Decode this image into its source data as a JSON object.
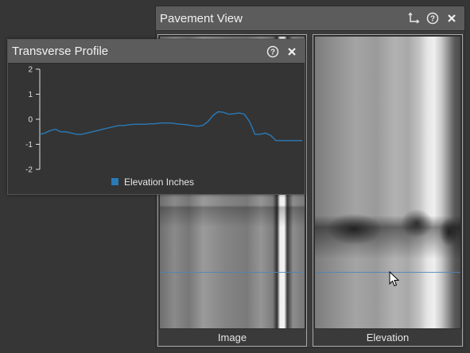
{
  "pavement_view": {
    "title": "Pavement View",
    "panes": [
      {
        "label": "Image"
      },
      {
        "label": "Elevation"
      }
    ]
  },
  "transverse_profile": {
    "title": "Transverse Profile"
  },
  "icons": {
    "move": "move-axes-icon",
    "help": "help-icon",
    "close": "close-icon",
    "cursor": "mouse-pointer-icon"
  },
  "colors": {
    "series": "#2a7ab8",
    "header": "#5c5c5c",
    "profile_marker": "#4d82b8"
  },
  "chart_data": {
    "type": "line",
    "ylim": [
      -2,
      2
    ],
    "yticks": [
      "2",
      "1",
      "0",
      "-1",
      "-2"
    ],
    "series": [
      {
        "name": "Elevation Inches",
        "x": [
          0,
          2,
          4,
          6,
          8,
          10,
          12,
          14,
          16,
          18,
          20,
          22,
          24,
          26,
          28,
          30,
          32,
          34,
          36,
          38,
          40,
          42,
          44,
          46,
          48,
          50,
          52,
          54,
          56,
          58,
          60,
          62,
          64,
          66,
          68,
          70,
          72,
          74,
          76,
          78,
          80,
          82,
          84,
          86,
          88,
          90,
          92,
          94,
          96,
          98,
          100
        ],
        "values": [
          -0.6,
          -0.55,
          -0.45,
          -0.4,
          -0.5,
          -0.5,
          -0.55,
          -0.6,
          -0.6,
          -0.55,
          -0.5,
          -0.45,
          -0.4,
          -0.35,
          -0.3,
          -0.25,
          -0.25,
          -0.22,
          -0.2,
          -0.2,
          -0.2,
          -0.18,
          -0.18,
          -0.15,
          -0.15,
          -0.15,
          -0.18,
          -0.2,
          -0.22,
          -0.25,
          -0.28,
          -0.25,
          -0.1,
          0.15,
          0.3,
          0.28,
          0.2,
          0.22,
          0.25,
          0.2,
          -0.1,
          -0.6,
          -0.6,
          -0.55,
          -0.65,
          -0.85,
          -0.85,
          -0.85,
          -0.85,
          -0.85,
          -0.85
        ]
      }
    ]
  }
}
